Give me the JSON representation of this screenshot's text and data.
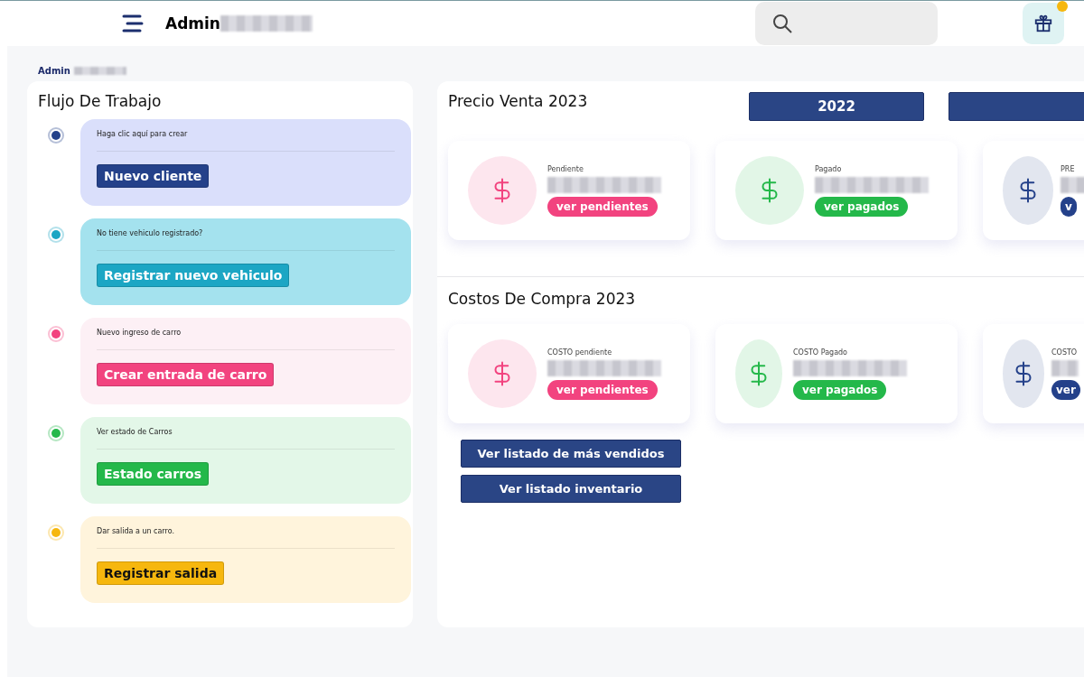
{
  "header": {
    "title": "Admin"
  },
  "breadcrumb": "Admin",
  "workflow": {
    "title": "Flujo De Trabajo",
    "steps": [
      {
        "text": "Haga clic aquí para crear",
        "button": "Nuevo cliente",
        "color": "#24418a"
      },
      {
        "text": "No tiene vehiculo registrado?",
        "button": "Registrar nuevo vehiculo",
        "color": "#1ca6c4"
      },
      {
        "text": "Nuevo ingreso de carro",
        "button": "Crear entrada de carro",
        "color": "#f2437f"
      },
      {
        "text": "Ver estado de Carros",
        "button": "Estado carros",
        "color": "#24b84a"
      },
      {
        "text": "Dar salida a un carro.",
        "button": "Registrar salida",
        "color": "#f6b70e"
      }
    ]
  },
  "years": [
    {
      "kind": "year",
      "label": "2022"
    },
    {
      "kind": "cut"
    }
  ],
  "sections": [
    {
      "title": "Precio Venta 2023",
      "cards": [
        {
          "label": "Pendiente",
          "button": "ver pendientes",
          "color": "#f2437f"
        },
        {
          "label": "Pagado",
          "button": "ver pagados",
          "color": "#24b84a"
        },
        {
          "label": "PRE",
          "button": "v",
          "color": "#24418a"
        }
      ]
    },
    {
      "title": "Costos De Compra 2023",
      "cards": [
        {
          "label": "COSTO pendiente",
          "button": "ver pendientes",
          "color": "#f2437f"
        },
        {
          "label": "COSTO Pagado",
          "button": "ver pagados",
          "color": "#24b84a"
        },
        {
          "label": "COSTO",
          "button": "ver",
          "color": "#24418a"
        }
      ]
    }
  ],
  "links": [
    "Ver listado de más vendidos",
    "Ver listado inventario"
  ]
}
